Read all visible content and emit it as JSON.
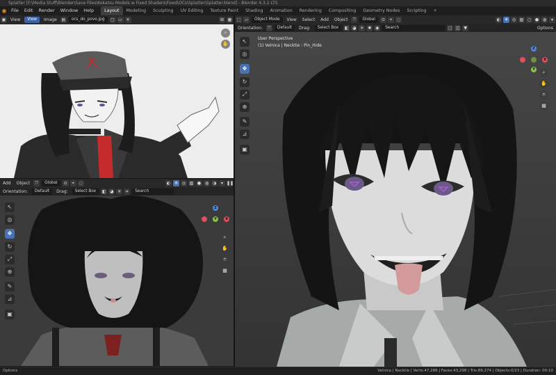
{
  "window": {
    "title": "Splatter [F:\\Media Stuff\\Blender\\Save Files\\Kokatsu Models w Fixed Shaders\\Fixed\\OCs\\Splatter\\Splatter.blend] - Blender 4.3.2 LTS"
  },
  "menu": {
    "items": [
      "File",
      "Edit",
      "Render",
      "Window",
      "Help"
    ]
  },
  "workspaces": [
    "Layout",
    "Modeling",
    "Sculpting",
    "UV Editing",
    "Texture Paint",
    "Shading",
    "Animation",
    "Rendering",
    "Compositing",
    "Geometry Nodes",
    "Scripting"
  ],
  "image_editor": {
    "view_label": "View",
    "view_tab": "View",
    "image_label": "Image",
    "filename": "ocs_do_povo.jpg"
  },
  "viewport_small": {
    "add": "Add",
    "object": "Object",
    "orientation_label": "Orientation:",
    "orientation_value": "Default",
    "drag_label": "Drag:",
    "drag_value": "Select Box",
    "transform": "Global",
    "search_placeholder": "Search"
  },
  "viewport_main": {
    "mode": "Object Mode",
    "view": "View",
    "select": "Select",
    "add": "Add",
    "object": "Object",
    "transform": "Global",
    "orientation_label": "Orientation:",
    "orientation_value": "Default",
    "drag_label": "Drag:",
    "drag_value": "Select Box",
    "search_placeholder": "Search",
    "options": "Options",
    "perspective": "User Perspective",
    "object_info": "(1) Velnica | Necktie : Pin_Hide"
  },
  "status": {
    "left": "Options",
    "right": "Velnica | Necktie | Verts:47,286 | Faces:43,298 | Tris:89,274 | Objects:0/23 | Duration: 00:10"
  },
  "gizmo": {
    "x": "X",
    "y": "Y",
    "z": "Z"
  },
  "colors": {
    "accent": "#4772b3",
    "x_axis": "#e04f5f",
    "y_axis": "#8bc34a",
    "z_axis": "#4d8de0"
  },
  "icons": {
    "tools": [
      "cursor-icon",
      "cursor-3d-icon",
      "move-icon",
      "rotate-icon",
      "scale-icon",
      "transform-icon",
      "annotate-icon",
      "measure-icon",
      "add-cube-icon"
    ],
    "nav": [
      "zoom-icon",
      "pan-hand-icon",
      "camera-icon",
      "grid-toggle-icon"
    ]
  }
}
